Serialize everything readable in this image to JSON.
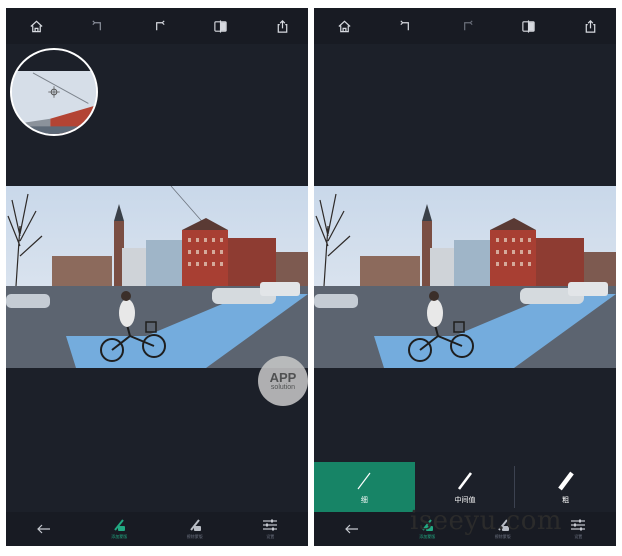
{
  "left_screen": {
    "topbar": {
      "icons": [
        "home-icon",
        "undo-icon",
        "redo-icon",
        "compare-icon",
        "share-icon"
      ]
    },
    "bottombar": {
      "items": [
        {
          "icon": "back-arrow-icon",
          "label": ""
        },
        {
          "icon": "brush-add-icon",
          "label": "添加蒙版",
          "active": true
        },
        {
          "icon": "brush-erase-icon",
          "label": "擦除蒙版",
          "active": false
        },
        {
          "icon": "sliders-icon",
          "label": "设置",
          "active": false
        }
      ]
    }
  },
  "right_screen": {
    "topbar": {
      "icons": [
        "home-icon",
        "undo-icon",
        "redo-icon",
        "compare-icon",
        "share-icon"
      ]
    },
    "brush_sizes": [
      {
        "label": "细",
        "selected": true
      },
      {
        "label": "中间值",
        "selected": false
      },
      {
        "label": "粗",
        "selected": false
      }
    ],
    "bottombar": {
      "items": [
        {
          "icon": "back-arrow-icon",
          "label": ""
        },
        {
          "icon": "brush-add-icon",
          "label": "添加蒙版",
          "active": true
        },
        {
          "icon": "brush-erase-icon",
          "label": "擦除蒙版",
          "active": false
        },
        {
          "icon": "sliders-icon",
          "label": "设置",
          "active": false
        }
      ]
    }
  },
  "colors": {
    "accent": "#178466",
    "accent_text": "#22a982",
    "background": "#1c2029",
    "bar": "#181b23",
    "mask_blue": "#78b8f0"
  },
  "watermark": {
    "badge_main": "APP",
    "badge_sub": "solution",
    "site": "iseeyu.com"
  }
}
